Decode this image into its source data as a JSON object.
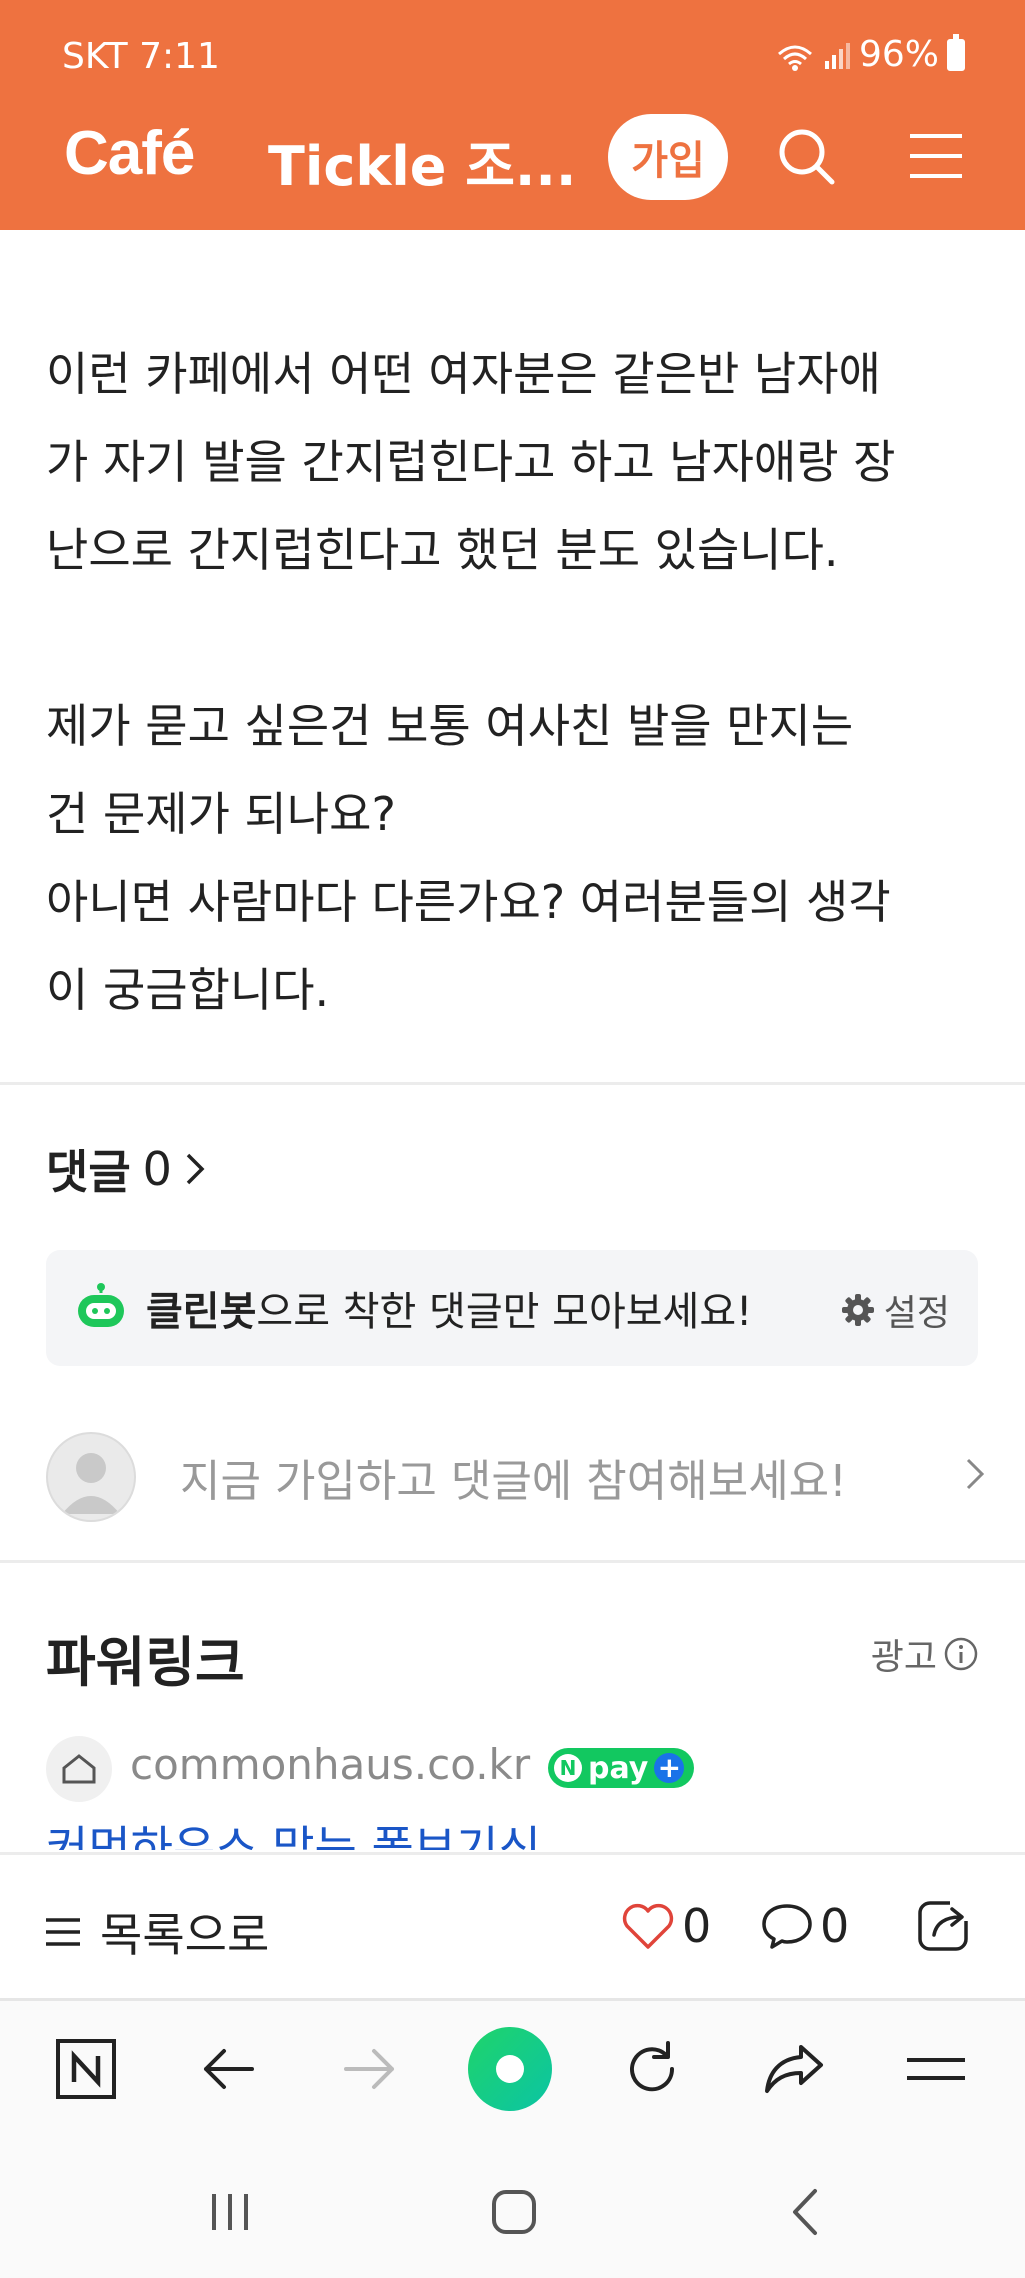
{
  "status_bar": {
    "carrier_time": "SKT 7:11",
    "battery": "96%"
  },
  "header": {
    "logo": "Café",
    "cafe_name": "Tickle 조...",
    "join_label": "가입",
    "accent_color": "#EE7240"
  },
  "article": {
    "body": "이런 카페에서 어떤 여자분은 같은반 남자애\n가 자기 발을 간지럽힌다고 하고 남자애랑 장\n난으로 간지럽힌다고 했던 분도 있습니다.\n\n제가 묻고 싶은건 보통 여사친 발을 만지는\n건 문제가 되나요?\n아니면 사람마다 다른가요? 여러분들의 생각\n이 궁금합니다."
  },
  "comments": {
    "label": "댓글",
    "count": "0",
    "cleanbot_bold": "클린봇",
    "cleanbot_rest": "으로 착한 댓글만 모아보세요!",
    "settings_label": "설정",
    "prompt": "지금 가입하고 댓글에 참여해보세요!"
  },
  "powerlink": {
    "title": "파워링크",
    "ad_label": "광고",
    "domain": "commonhaus.co.kr",
    "npay": "pay",
    "headline": "커먼하우스 맞는 폴브기신"
  },
  "article_bar": {
    "list_label": "목록으로",
    "like_count": "0",
    "comment_count": "0"
  },
  "icons": {
    "search": "search-icon",
    "menu": "menu-icon",
    "cleanbot": "robot-icon",
    "gear": "gear-icon",
    "info": "info-icon",
    "heart": "heart-icon",
    "speech": "comment-icon",
    "share": "share-icon",
    "naver_home": "naver-n-icon",
    "green_dot": "naver-green-dot-icon"
  }
}
